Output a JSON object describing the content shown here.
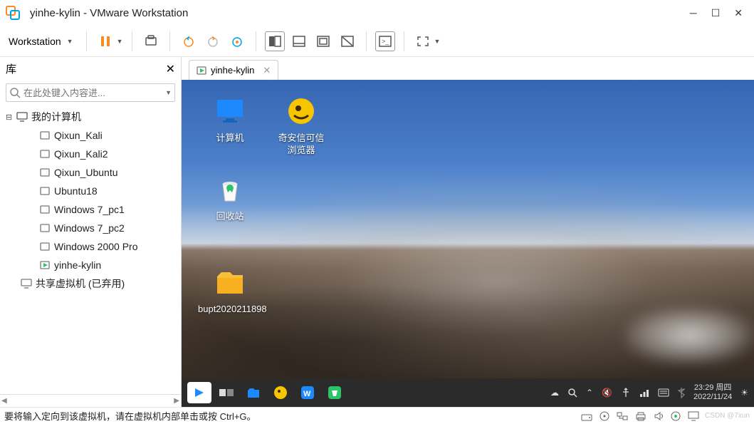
{
  "window": {
    "title": "yinhe-kylin - VMware Workstation",
    "menu_label": "Workstation"
  },
  "library": {
    "header": "库",
    "search_placeholder": "在此处键入内容进...",
    "root": "我的计算机",
    "vms": [
      "Qixun_Kali",
      "Qixun_Kali2",
      "Qixun_Ubuntu",
      "Ubuntu18",
      "Windows 7_pc1",
      "Windows 7_pc2",
      "Windows 2000 Pro",
      "yinhe-kylin"
    ],
    "shared": "共享虚拟机 (已弃用)"
  },
  "vm_tab": {
    "label": "yinhe-kylin"
  },
  "desktop": {
    "computer": "计算机",
    "browser": "奇安信可信\n浏览器",
    "trash": "回收站",
    "folder": "bupt2020211898"
  },
  "guest_clock": {
    "time": "23:29",
    "day": "周四",
    "date": "2022/11/24"
  },
  "statusbar": {
    "message": "要将输入定向到该虚拟机，请在虚拟机内部单击或按 Ctrl+G。",
    "watermark": "CSDN @7xun"
  },
  "colors": {
    "vmware_orange": "#f68b1f",
    "pause_orange": "#f68b1f",
    "kylin_blue": "#1e88ff",
    "browser_yellow": "#f6c500",
    "wps_blue": "#1e88ff",
    "green": "#2cc36b",
    "folder_yellow": "#f8c038"
  }
}
